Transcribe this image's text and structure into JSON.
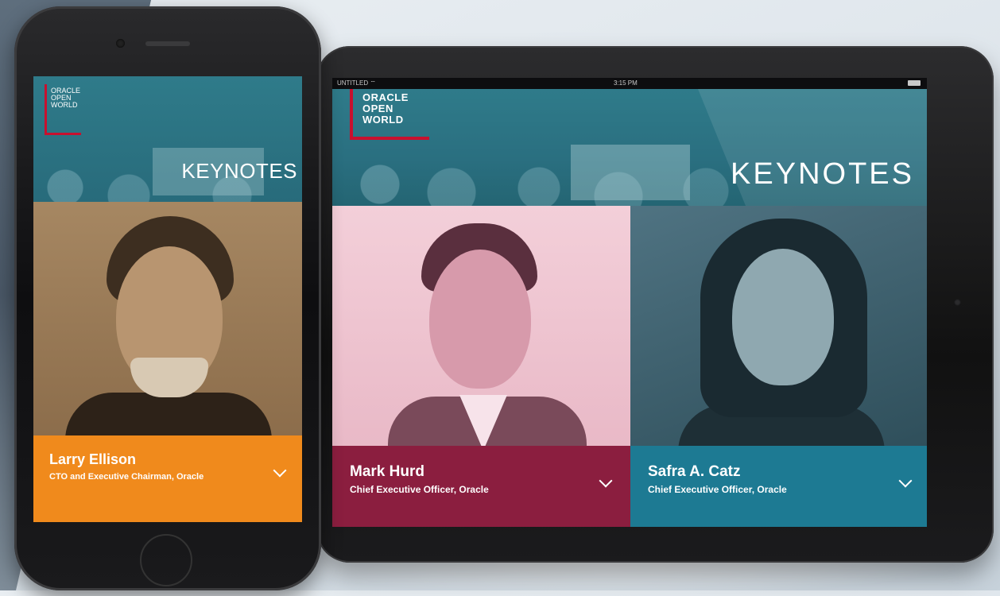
{
  "colors": {
    "teal_header": "#2a6f80",
    "logo_red": "#c8102e",
    "orange_caption": "#f08a1c",
    "maroon_caption": "#8b1e3f",
    "blue_caption": "#1d7a93",
    "pink_photo": "#f1c8d3",
    "sepia_photo": "#9c7e5a",
    "slate_photo": "#3d5f6c"
  },
  "logo": {
    "line1": "ORACLE",
    "line2": "OPEN",
    "line3": "WORLD"
  },
  "iphone": {
    "title": "KEYNOTES",
    "speaker": {
      "name": "Larry Ellison",
      "role": "CTO and Executive Chairman, Oracle"
    }
  },
  "ipad": {
    "status": {
      "carrier": "UNTITLED ⌔",
      "time": "3:15 PM"
    },
    "title": "KEYNOTES",
    "speakers": [
      {
        "name": "Mark Hurd",
        "role": "Chief Executive Officer, Oracle"
      },
      {
        "name": "Safra A. Catz",
        "role": "Chief Executive Officer, Oracle"
      }
    ]
  },
  "icons": [
    "chevron-down-icon",
    "battery-icon"
  ]
}
